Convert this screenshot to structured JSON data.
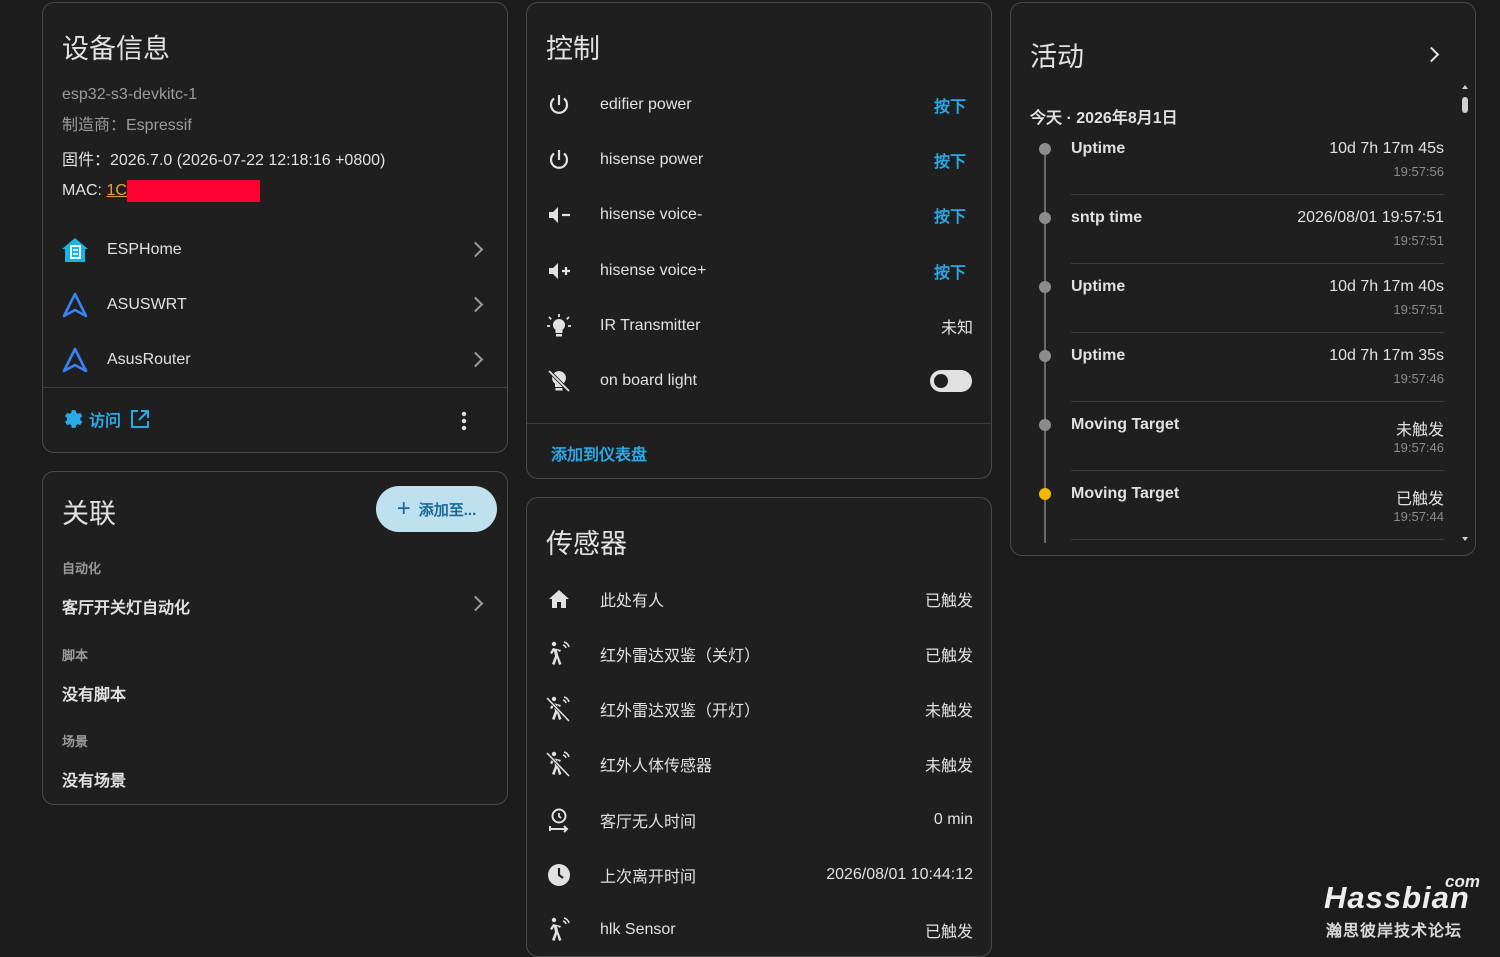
{
  "device_info": {
    "title": "设备信息",
    "model": "esp32-s3-devkitc-1",
    "manufacturer": "制造商：Espressif",
    "firmware": "固件：2026.7.0 (2026-07-22 12:18:16 +0800)",
    "mac_label": "MAC: ",
    "mac_value": "1C",
    "integrations": [
      {
        "label": "ESPHome",
        "icon": "esphome-icon"
      },
      {
        "label": "ASUSWRT",
        "icon": "asus-icon"
      },
      {
        "label": "AsusRouter",
        "icon": "asus-icon"
      }
    ],
    "visit_label": "访问",
    "colors": {
      "accent": "#2aa9e6",
      "mac_redact": "#ff0033",
      "mac_link": "#e8a33b"
    }
  },
  "related": {
    "title": "关联",
    "add_button": "添加至...",
    "automation_section": "自动化",
    "automation_item": "客厅开关灯自动化",
    "script_section": "脚本",
    "script_item": "没有脚本",
    "scene_section": "场景",
    "scene_item": "没有场景"
  },
  "controls": {
    "title": "控制",
    "items": [
      {
        "label": "edifier power",
        "icon": "power-icon",
        "value": "按下"
      },
      {
        "label": "hisense power",
        "icon": "power-icon",
        "value": "按下"
      },
      {
        "label": "hisense voice-",
        "icon": "volume-minus-icon",
        "value": "按下"
      },
      {
        "label": "hisense voice+",
        "icon": "volume-plus-icon",
        "value": "按下"
      },
      {
        "label": "IR Transmitter",
        "icon": "light-bulb-on-icon",
        "value": "未知"
      },
      {
        "label": "on board light",
        "icon": "light-bulb-off-icon",
        "value": ""
      }
    ],
    "add_to_dashboard": "添加到仪表盘"
  },
  "sensors": {
    "title": "传感器",
    "items": [
      {
        "label": "此处有人",
        "icon": "home-icon",
        "value": "已触发"
      },
      {
        "label": "红外雷达双鉴（关灯）",
        "icon": "motion-sensor-icon",
        "value": "已触发"
      },
      {
        "label": "红外雷达双鉴（开灯）",
        "icon": "motion-sensor-off-icon",
        "value": "未触发"
      },
      {
        "label": "红外人体传感器",
        "icon": "motion-sensor-off-icon",
        "value": "未触发"
      },
      {
        "label": "客厅无人时间",
        "icon": "timer-icon",
        "value": "0 min"
      },
      {
        "label": "上次离开时间",
        "icon": "clock-icon",
        "value": "2026/08/01 10:44:12"
      },
      {
        "label": "hlk Sensor",
        "icon": "motion-sensor-icon",
        "value": "已触发"
      }
    ]
  },
  "activity": {
    "title": "活动",
    "date_header": "今天 · 2026年8月1日",
    "items": [
      {
        "name": "Uptime",
        "value": "10d 7h 17m 45s",
        "time": "19:57:56",
        "dot": "#8c8c8c"
      },
      {
        "name": "sntp time",
        "value": "2026/08/01 19:57:51",
        "time": "19:57:51",
        "dot": "#8c8c8c"
      },
      {
        "name": "Uptime",
        "value": "10d 7h 17m 40s",
        "time": "19:57:51",
        "dot": "#8c8c8c"
      },
      {
        "name": "Uptime",
        "value": "10d 7h 17m 35s",
        "time": "19:57:46",
        "dot": "#8c8c8c"
      },
      {
        "name": "Moving Target",
        "value": "未触发",
        "time": "19:57:46",
        "dot": "#8c8c8c"
      },
      {
        "name": "Moving Target",
        "value": "已触发",
        "time": "19:57:44",
        "dot": "#f5b800"
      }
    ]
  },
  "watermark": {
    "brand": "Hassbian",
    "tld": "com",
    "subtitle": "瀚思彼岸技术论坛"
  }
}
